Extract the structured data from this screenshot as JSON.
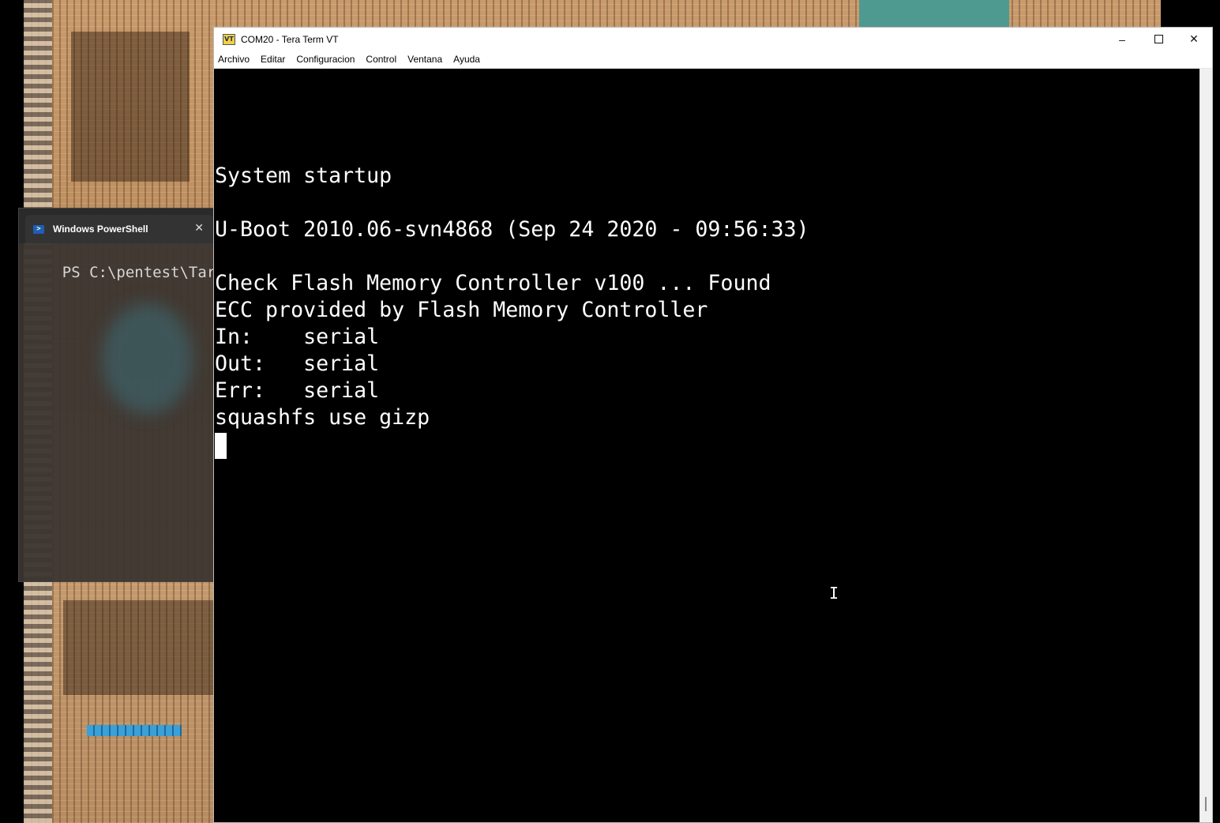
{
  "powershell": {
    "tab_title": "Windows PowerShell",
    "prompt_text": "PS C:\\pentest\\Tarl"
  },
  "teraterm": {
    "title": "COM20 - Tera Term VT",
    "menu": [
      "Archivo",
      "Editar",
      "Configuracion",
      "Control",
      "Ventana",
      "Ayuda"
    ],
    "terminal_lines": [
      "System startup",
      "",
      "U-Boot 2010.06-svn4868 (Sep 24 2020 - 09:56:33)",
      "",
      "Check Flash Memory Controller v100 ... Found",
      "ECC provided by Flash Memory Controller",
      "In:    serial",
      "Out:   serial",
      "Err:   serial",
      "squashfs use gizp"
    ]
  }
}
